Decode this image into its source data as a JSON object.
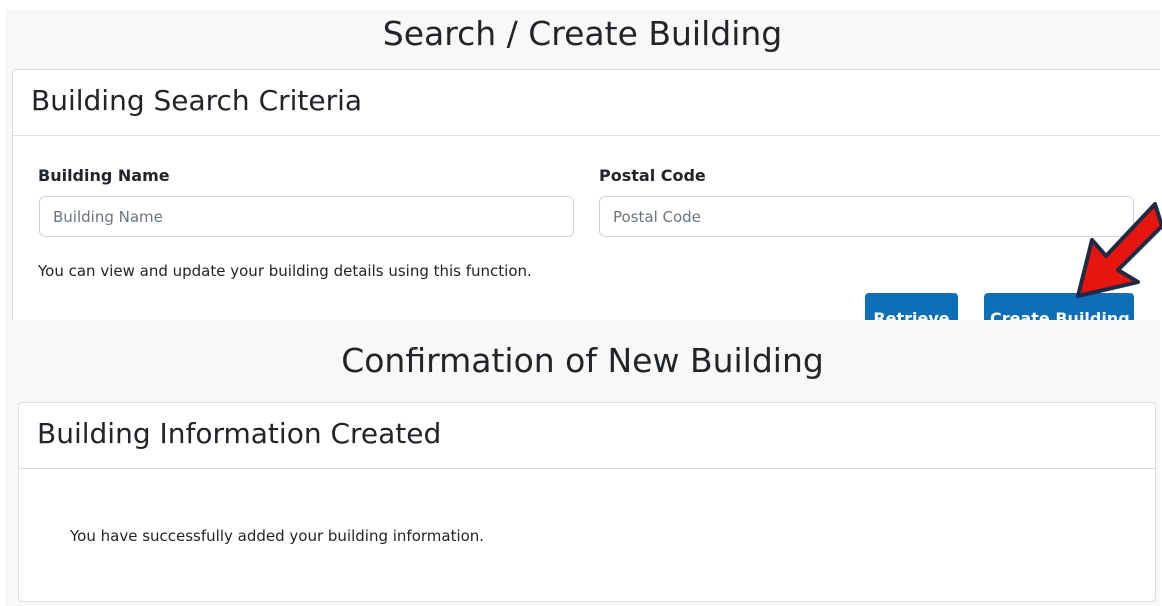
{
  "search_panel": {
    "title": "Search / Create Building",
    "card_title": "Building Search Criteria",
    "building_name_label": "Building Name",
    "building_name_placeholder": "Building Name",
    "building_name_value": "",
    "postal_code_label": "Postal Code",
    "postal_code_placeholder": "Postal Code",
    "postal_code_value": "",
    "help_text": "You can view and update your building details using this function.",
    "retrieve_label": "Retrieve",
    "create_building_label": "Create Building"
  },
  "confirmation_panel": {
    "title": "Confirmation of New Building",
    "card_title": "Building Information Created",
    "message": "You have successfully added your building information."
  },
  "colors": {
    "button_bg": "#0d6fb8",
    "arrow_fill": "#e8150f",
    "arrow_outline": "#1f2a44",
    "panel_bg": "#f8f8f8"
  }
}
